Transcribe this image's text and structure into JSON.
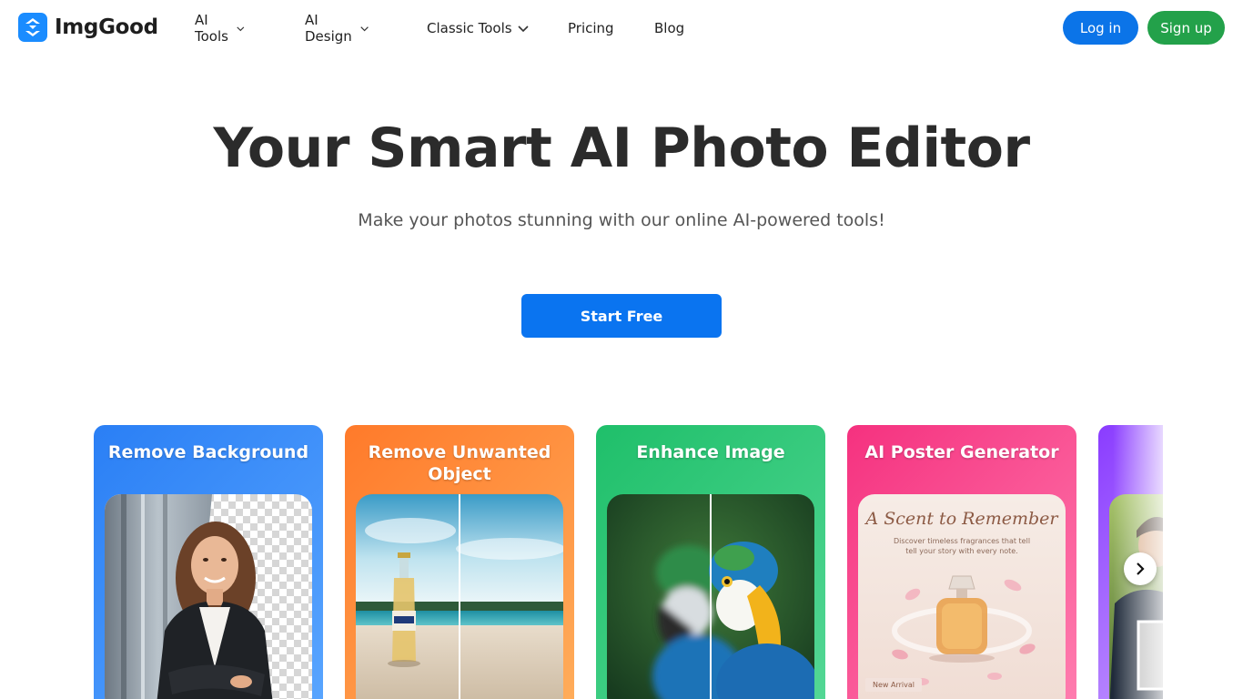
{
  "brand": {
    "name": "ImgGood"
  },
  "nav": {
    "items": [
      {
        "label": "AI Tools",
        "has_dropdown": true
      },
      {
        "label": "AI Design",
        "has_dropdown": true
      },
      {
        "label": "Classic Tools",
        "has_dropdown": true
      },
      {
        "label": "Pricing",
        "has_dropdown": false
      },
      {
        "label": "Blog",
        "has_dropdown": false
      }
    ]
  },
  "auth": {
    "login_label": "Log in",
    "signup_label": "Sign up"
  },
  "hero": {
    "title": "Your Smart AI Photo Editor",
    "subtitle": "Make your photos stunning with our online AI-powered tools!",
    "cta_label": "Start Free"
  },
  "cards": [
    {
      "title": "Remove Background"
    },
    {
      "title": "Remove Unwanted Object"
    },
    {
      "title": "Enhance Image"
    },
    {
      "title": "AI Poster Generator"
    },
    {
      "title": ""
    }
  ],
  "poster": {
    "title": "A Scent to Remember",
    "subtitle": "Discover timeless fragrances that tell tell your story with every note.",
    "badge": "New Arrival"
  },
  "colors": {
    "login_bg": "#0b74e8",
    "signup_bg": "#23a14a",
    "cta_bg": "#0a74f0",
    "card_blue": "#2a7ff5",
    "card_orange": "#ff7a2a",
    "card_green": "#1fbf6a",
    "card_pink": "#f5317f",
    "card_purple": "#8a3cff"
  },
  "icons": [
    "logo-icon",
    "chevron-down-icon",
    "chevron-right-icon"
  ]
}
